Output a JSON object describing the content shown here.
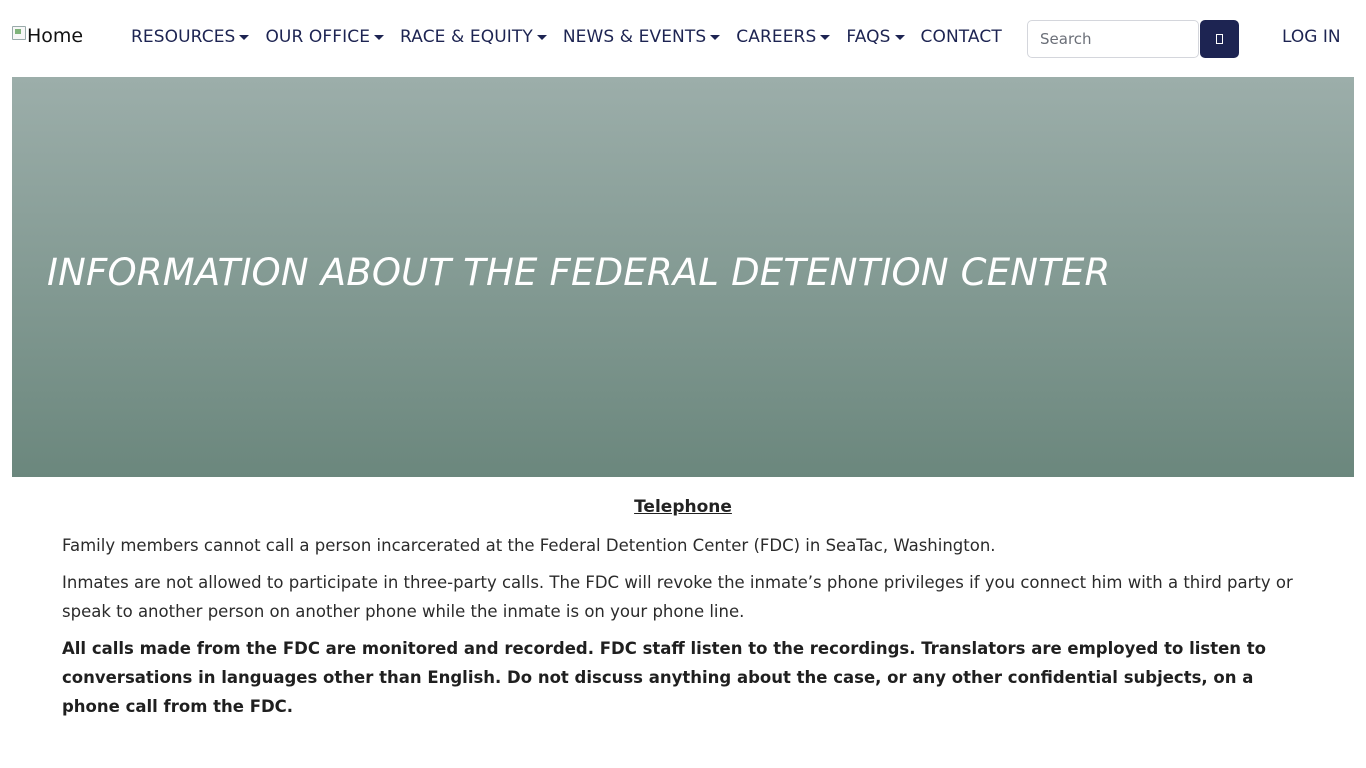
{
  "nav": {
    "logo_alt": "Home",
    "items": [
      {
        "label": "RESOURCES",
        "dropdown": true
      },
      {
        "label": "OUR OFFICE",
        "dropdown": true
      },
      {
        "label": "RACE & EQUITY",
        "dropdown": true
      },
      {
        "label": "NEWS & EVENTS",
        "dropdown": true
      },
      {
        "label": "CAREERS",
        "dropdown": true
      },
      {
        "label": "FAQS",
        "dropdown": true
      },
      {
        "label": "CONTACT",
        "dropdown": false
      }
    ],
    "search_placeholder": "Search",
    "search_button_icon": "search-icon",
    "login_label": "LOG IN"
  },
  "hero": {
    "title": "INFORMATION ABOUT THE FEDERAL DETENTION CENTER"
  },
  "content": {
    "heading": "Telephone",
    "paragraphs": [
      "Family members cannot call a person incarcerated at the Federal Detention Center (FDC) in SeaTac, Washington.",
      "Inmates are not allowed to participate in three-party calls. The FDC will revoke the inmate’s phone privileges if you connect him with a third party or speak to another person on another phone while the inmate is on your phone line.",
      "All calls made from the FDC are monitored and recorded. FDC staff listen to the recordings. Translators are employed to listen to conversations in languages other than English. Do not discuss anything about the case, or any other confidential subjects, on a phone call from the FDC."
    ]
  },
  "colors": {
    "nav_text": "#1d2452",
    "search_button_bg": "#1d2452",
    "hero_gradient_top": "#9caeaa",
    "hero_gradient_bottom": "#6b877d"
  }
}
